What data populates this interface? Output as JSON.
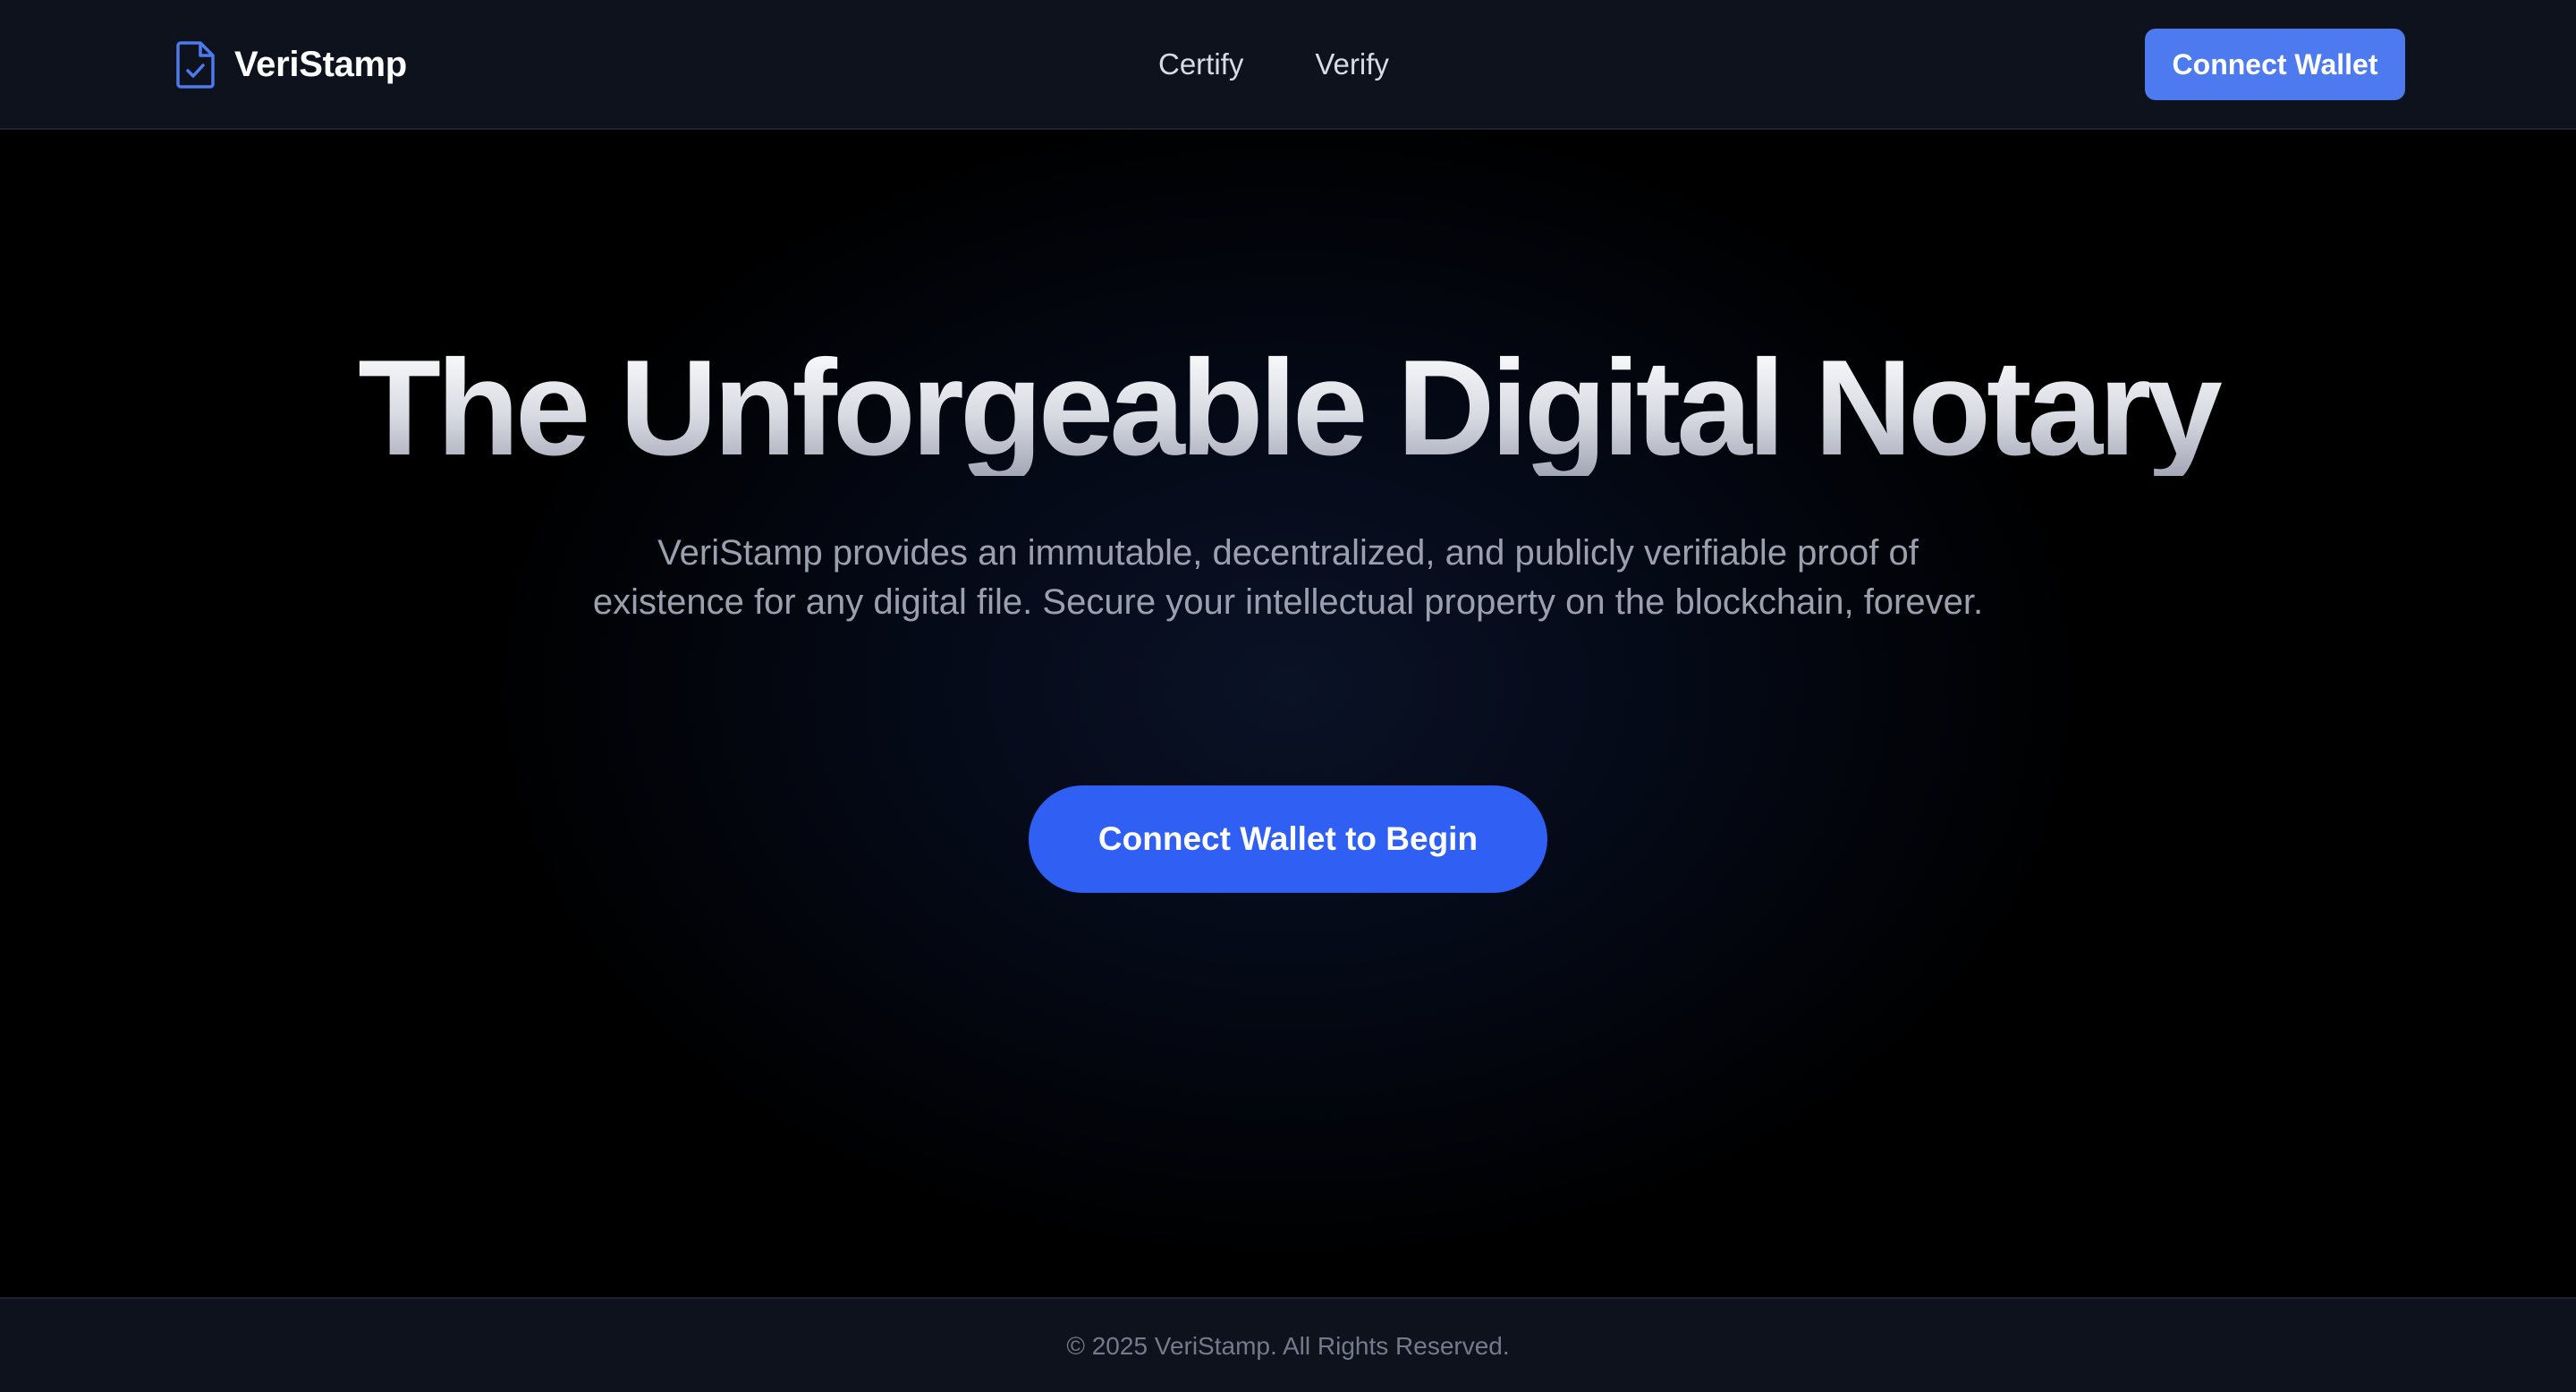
{
  "header": {
    "brand_name": "VeriStamp",
    "brand_icon": "file-check-icon",
    "nav": [
      {
        "label": "Certify"
      },
      {
        "label": "Verify"
      }
    ],
    "connect_button_label": "Connect Wallet"
  },
  "hero": {
    "title": "The Unforgeable Digital Notary",
    "subtitle": "VeriStamp provides an immutable, decentralized, and publicly verifiable proof of existence for any digital file. Secure your intellectual property on the blockchain, forever.",
    "cta_label": "Connect Wallet to Begin"
  },
  "footer": {
    "copyright": "© 2025 VeriStamp. All Rights Reserved."
  },
  "colors": {
    "accent": "#4d7bef",
    "cta": "#2f5ff3",
    "header_bg": "#0d121d",
    "page_bg": "#000000"
  }
}
